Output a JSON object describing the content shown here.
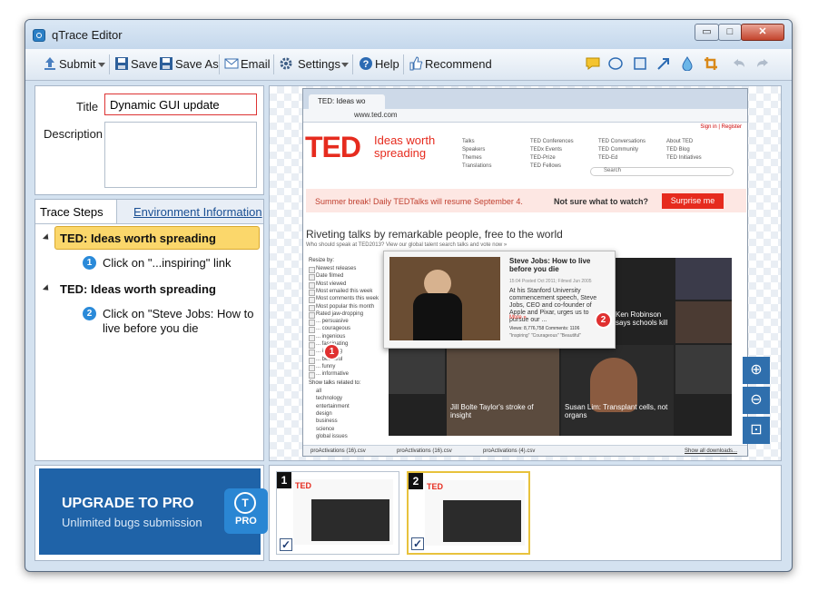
{
  "window": {
    "title": "qTrace Editor",
    "min": "▭",
    "max": "□",
    "close": "✕"
  },
  "toolbar": {
    "submit": "Submit",
    "save": "Save",
    "save_as": "Save As",
    "email": "Email",
    "settings": "Settings",
    "help": "Help",
    "recommend": "Recommend"
  },
  "form": {
    "title_label": "Title",
    "title_value": "Dynamic GUI update",
    "description_label": "Description",
    "description_value": ""
  },
  "tabs": {
    "trace_steps": "Trace Steps",
    "environment": "Environment Information"
  },
  "steps": [
    {
      "group": "TED: Ideas worth spreading",
      "number": "1",
      "text": "Click on \"...inspiring\" link"
    },
    {
      "group": "TED: Ideas worth spreading",
      "number": "2",
      "text": "Click on \"Steve Jobs: How to live before you die"
    }
  ],
  "promo": {
    "title": "UPGRADE TO PRO",
    "subtitle": "Unlimited bugs submission",
    "badge": "PRO",
    "logo": "T"
  },
  "thumbnails": [
    {
      "number": "1",
      "checked": "✓"
    },
    {
      "number": "2",
      "checked": "✓"
    }
  ],
  "zoom": {
    "in": "⊕",
    "out": "⊖",
    "fit": "⊡"
  },
  "browser": {
    "tab_title": "TED: Ideas wo",
    "url": "www.ted.com",
    "sign": "Sign in | Register",
    "logo": "TED",
    "tagline": "Ideas worth spreading",
    "nav": [
      "Talks",
      "TED Conferences",
      "TED Conversations",
      "About TED",
      "Speakers",
      "TEDx Events",
      "TED Community",
      "TED Blog",
      "Themes",
      "TED-Prize",
      "TED-Ed",
      "TED Initiatives",
      "Translations",
      "TED Fellows"
    ],
    "search": "Search",
    "banner": "Summer break! Daily TEDTalks will resume September 4.",
    "banner_q": "Not sure what to watch?",
    "surprise": "Surprise me",
    "heading": "Riveting talks by remarkable people, free to the world",
    "subheading": "Who should speak at TED2013? View our global talent search talks and vote now »",
    "resize": "Resize by:",
    "filters": [
      "Newest releases",
      "Date filmed",
      "Most viewed",
      "Most emailed this week",
      "Most comments this week",
      "Most popular this month",
      "Rated jaw-dropping",
      "... persuasive",
      "... courageous",
      "... ingenious",
      "... fascinating",
      "... inspiring",
      "... beautiful",
      "... funny",
      "... informative"
    ],
    "show": "Show talks related to:",
    "topics": [
      "all",
      "technology",
      "entertainment",
      "design",
      "business",
      "science",
      "global issues"
    ],
    "pop_title": "Steve Jobs: How to live before you die",
    "pop_meta": "15:04 Posted Oct 2011; Filmed Jun 2005",
    "pop_body": "At his Stanford University commencement speech, Steve Jobs, CEO and co-founder of Apple and Pixar, urges us to pursue our ...",
    "pop_more": "More »",
    "pop_stats": "Views: 8,776,758 Comments: 1106",
    "pop_tags": "\"Inspiring\" \"Courageous\" \"Beautiful\"",
    "grid_caption1": "Jill Bolte Taylor's stroke of insight",
    "grid_caption2": "Susan Lim: Transplant cells, not organs",
    "grid_caption3": "Ken Robinson says schools kill",
    "marker1": "1",
    "marker2": "2",
    "downloads": [
      "proActivations (16).csv",
      "proActivations (16).csv",
      "proActivations (4).csv"
    ],
    "show_all": "Show all downloads..."
  },
  "colors": {
    "accent": "#2f6fad",
    "ted_red": "#e62b1e",
    "step_highlight": "#fbd76b"
  }
}
